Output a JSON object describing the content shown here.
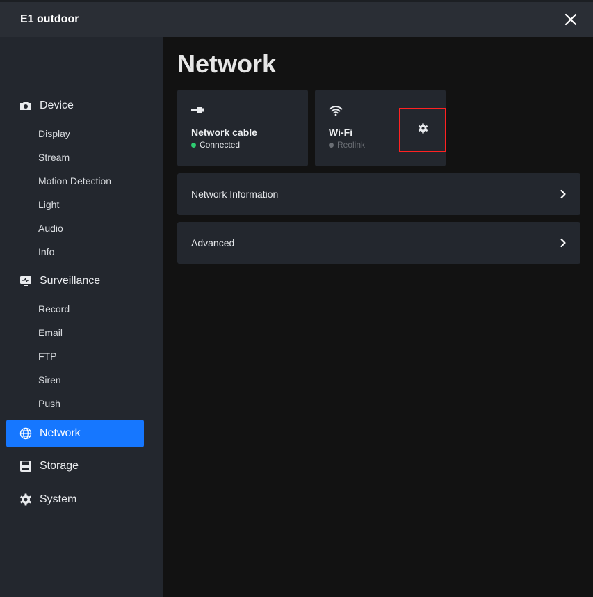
{
  "app": {
    "title": "E1 outdoor"
  },
  "sidebar": {
    "device": {
      "label": "Device",
      "icon": "camera-icon",
      "subs": [
        "Display",
        "Stream",
        "Motion Detection",
        "Light",
        "Audio",
        "Info"
      ]
    },
    "surveillance": {
      "label": "Surveillance",
      "icon": "monitor-icon",
      "subs": [
        "Record",
        "Email",
        "FTP",
        "Siren",
        "Push"
      ]
    },
    "network": {
      "label": "Network",
      "icon": "globe-icon",
      "active": true
    },
    "storage": {
      "label": "Storage",
      "icon": "floppy-disk-icon"
    },
    "system": {
      "label": "System",
      "icon": "gear-icon"
    }
  },
  "main": {
    "title": "Network",
    "cards": [
      {
        "name": "Network cable",
        "status": "Connected",
        "status_color": "#2ecc71",
        "icon": "ethernet-cable-icon"
      },
      {
        "name": "Wi-Fi",
        "status": "Reolink",
        "status_color": "#6b6f75",
        "icon": "wifi-icon",
        "settings_icon": "gear-icon"
      }
    ],
    "rows": [
      {
        "label": "Network Information"
      },
      {
        "label": "Advanced"
      }
    ]
  },
  "colors": {
    "accent": "#1677ff",
    "highlight": "#ff2222"
  }
}
